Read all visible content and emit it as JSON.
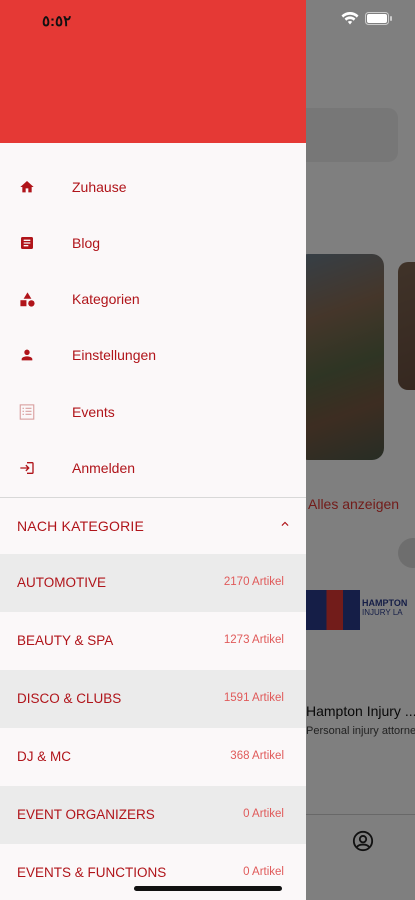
{
  "status_bar": {
    "time": "٥:٥٢",
    "icons": [
      "wifi-icon",
      "battery-icon"
    ]
  },
  "background": {
    "see_all_label": "Alles anzeigen",
    "logo_text": "HAMPTON",
    "logo_sub": "INJURY LA",
    "listing_title": "Hampton Injury ...",
    "listing_subtitle": "Personal injury attorne"
  },
  "drawer": {
    "menu": [
      {
        "id": "home",
        "label": "Zuhause",
        "icon": "home-icon"
      },
      {
        "id": "blog",
        "label": "Blog",
        "icon": "article-icon"
      },
      {
        "id": "categories",
        "label": "Kategorien",
        "icon": "category-shapes-icon"
      },
      {
        "id": "settings",
        "label": "Einstellungen",
        "icon": "person-icon"
      },
      {
        "id": "events",
        "label": "Events",
        "icon": "list-icon"
      },
      {
        "id": "login",
        "label": "Anmelden",
        "icon": "login-icon"
      }
    ],
    "section": {
      "title": "NACH KATEGORIE",
      "icon": "chevron-up-icon"
    },
    "categories": [
      {
        "name": "AUTOMOTIVE",
        "count": "2170 Artikel"
      },
      {
        "name": "BEAUTY & SPA",
        "count": "1273 Artikel"
      },
      {
        "name": "DISCO & CLUBS",
        "count": "1591 Artikel"
      },
      {
        "name": "DJ & MC",
        "count": "368 Artikel"
      },
      {
        "name": "EVENT ORGANIZERS",
        "count": "0 Artikel"
      },
      {
        "name": "EVENTS & FUNCTIONS",
        "count": "0 Artikel"
      }
    ]
  },
  "colors": {
    "accent": "#e53935",
    "text_accent": "#b0141a",
    "count_text": "#e05a5a",
    "drawer_bg": "#fbf8f9",
    "row_shaded": "#ebebeb"
  }
}
